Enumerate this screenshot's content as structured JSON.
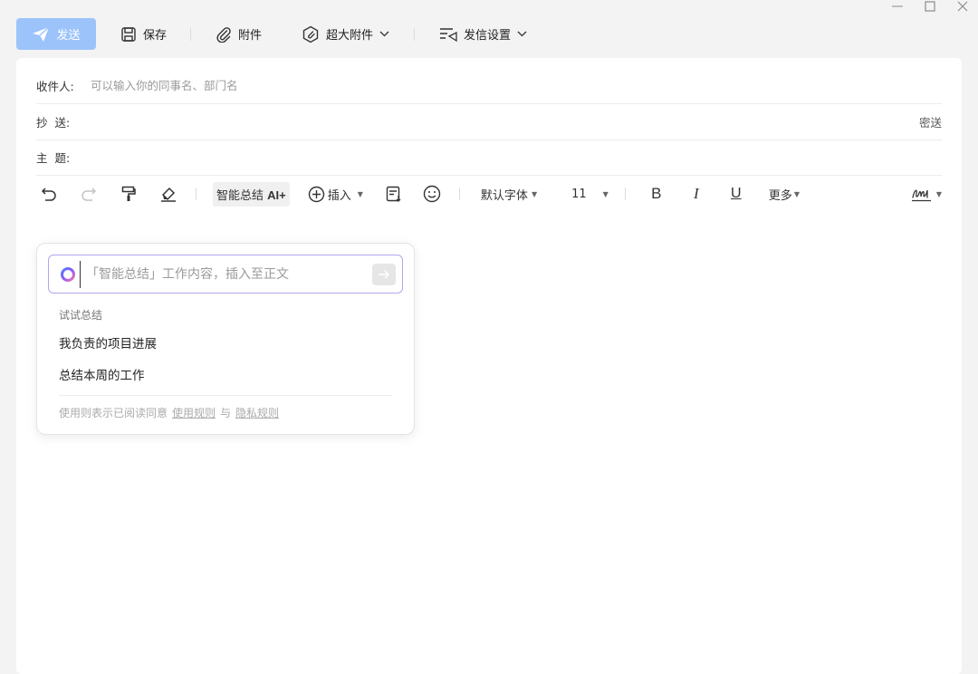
{
  "window": {
    "controls": {
      "minimize": "—",
      "maximize": "☐",
      "close": "✕"
    }
  },
  "toolbar": {
    "send_label": "发送",
    "save_label": "保存",
    "attach_label": "附件",
    "large_attach_label": "超大附件",
    "send_settings_label": "发信设置"
  },
  "compose": {
    "to_label": "收件人:",
    "to_placeholder": "可以输入你的同事名、部门名",
    "cc_label": "抄  送:",
    "bcc_label": "密送",
    "subject_label": "主  题:"
  },
  "format": {
    "ai_summary_label": "智能总结",
    "ai_badge": "AI+",
    "insert_label": "插入",
    "font_label": "默认字体",
    "font_size": "11",
    "bold": "B",
    "italic": "I",
    "underline": "U",
    "more_label": "更多"
  },
  "ai_popup": {
    "input_placeholder": "「智能总结」工作内容，插入至正文",
    "try_label": "试试总结",
    "suggestions": [
      "我负责的项目进展",
      "总结本周的工作"
    ],
    "terms_prefix": "使用则表示已阅读同意",
    "terms_link": "使用规则",
    "terms_and": "与",
    "privacy_link": "隐私规则"
  },
  "colors": {
    "send_button": "#9dc3fb",
    "ai_border": "#b4a6f0",
    "panel_bg": "#ffffff",
    "page_bg": "#f3f3f3"
  }
}
